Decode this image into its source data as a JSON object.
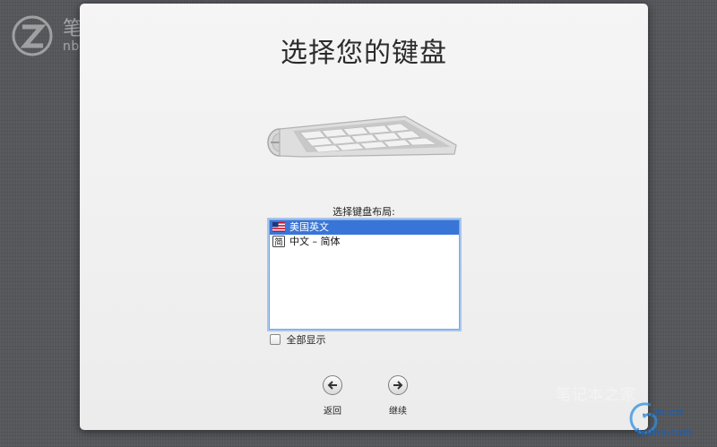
{
  "watermark_top": {
    "cn": "笔记本之家",
    "en": "nb.zol.com.cn"
  },
  "installer": {
    "title": "选择您的键盘",
    "layout_label": "选择键盘布局:",
    "layouts": [
      {
        "label": "美国英文",
        "icon": "us-flag-icon",
        "selected": true
      },
      {
        "label": "中文 – 简体",
        "icon": "simplified-chinese-input-icon",
        "badge": "简",
        "selected": false
      }
    ],
    "show_all_label": "全部显示",
    "show_all_checked": false,
    "back_label": "返回",
    "continue_label": "继续"
  },
  "watermark_bottom": {
    "cn": "笔记本之家",
    "url": "...m.cn",
    "site": "iyunv.com"
  },
  "colors": {
    "selection": "#3875d7",
    "list_focus_ring": "#7aa7e0",
    "desktop_bg": "#55575b",
    "panel_bg": "#f0f0f0"
  }
}
